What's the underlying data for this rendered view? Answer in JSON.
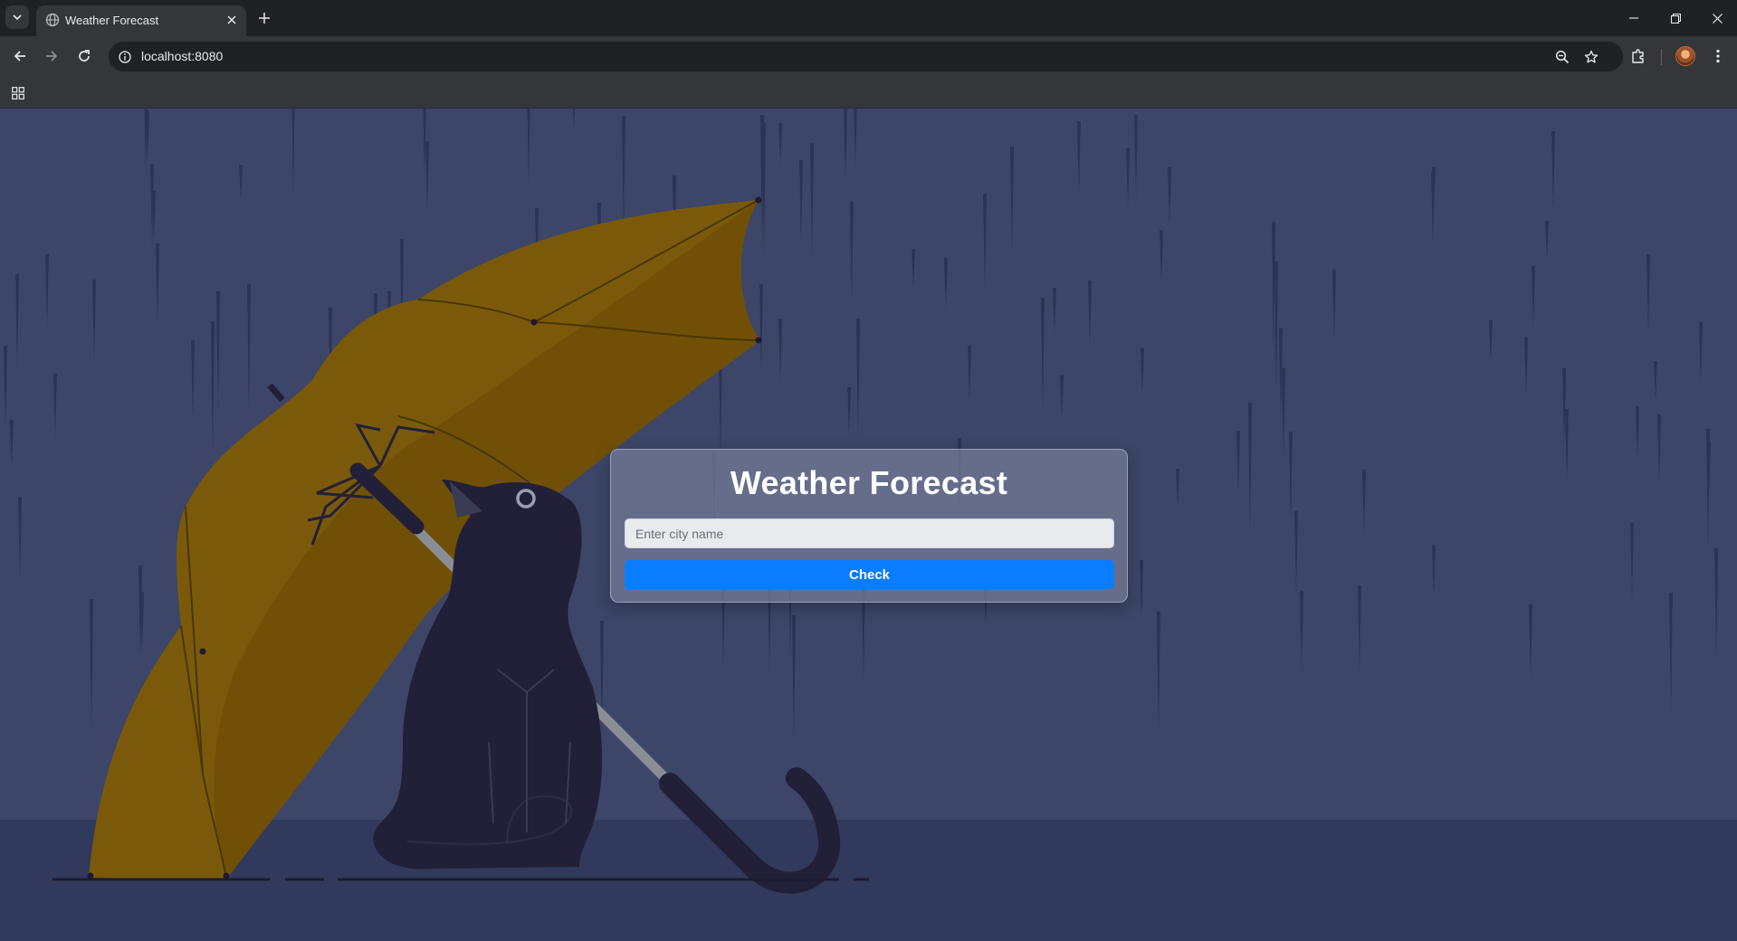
{
  "browser": {
    "tab": {
      "title": "Weather Forecast"
    },
    "address_bar": {
      "url": "localhost:8080"
    }
  },
  "page": {
    "title": "Weather Forecast",
    "city_input": {
      "placeholder": "Enter city name",
      "value": ""
    },
    "check_button_label": "Check"
  },
  "colors": {
    "sky": "#3d4568",
    "ground": "#31395c",
    "umbrella": "#7a5a0a",
    "cat": "#221f38",
    "button": "#0a7cff"
  },
  "icons": [
    "tab-search-icon",
    "globe-icon",
    "close-icon",
    "plus-icon",
    "minimize-icon",
    "restore-icon",
    "back-arrow-icon",
    "forward-arrow-icon",
    "reload-icon",
    "info-icon",
    "zoom-icon",
    "star-icon",
    "extensions-icon",
    "kebab-menu-icon",
    "apps-grid-icon"
  ]
}
